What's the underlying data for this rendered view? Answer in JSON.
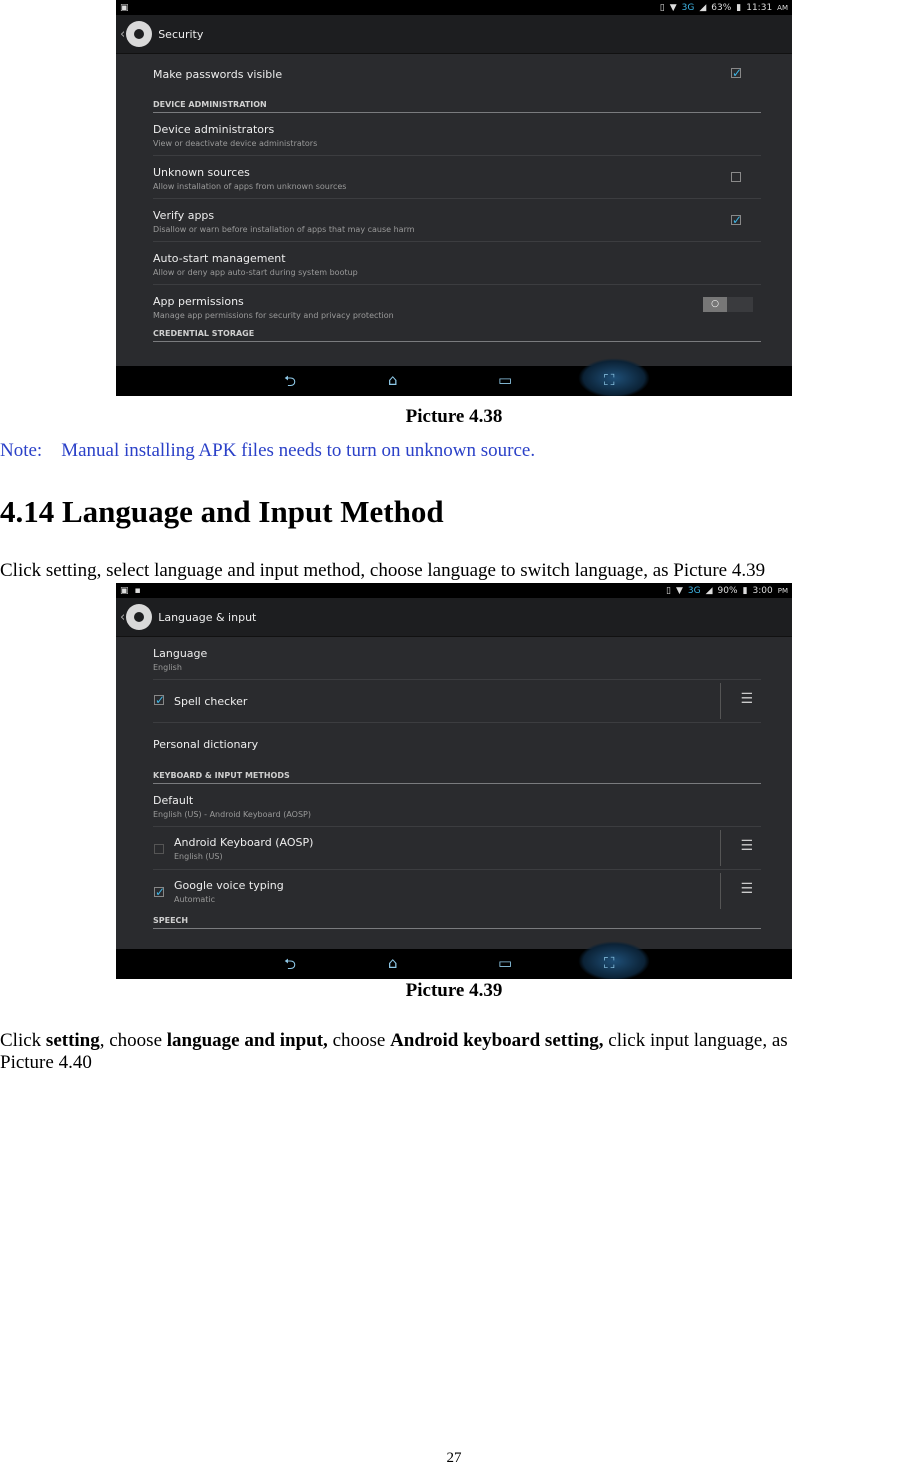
{
  "picture_38": {
    "statusbar": {
      "battery": "63%",
      "time": "11:31",
      "ampm": "AM",
      "network": "3G"
    },
    "title": "Security",
    "rows": [
      {
        "title": "Make passwords visible"
      },
      {
        "section": "DEVICE ADMINISTRATION"
      },
      {
        "title": "Device administrators",
        "subtitle": "View or deactivate device administrators"
      },
      {
        "title": "Unknown sources",
        "subtitle": "Allow installation of apps from unknown sources"
      },
      {
        "title": "Verify apps",
        "subtitle": "Disallow or warn before installation of apps that may cause harm"
      },
      {
        "title": "Auto-start management",
        "subtitle": "Allow or deny app auto-start during system bootup"
      },
      {
        "title": "App permissions",
        "subtitle": "Manage app permissions for security and privacy protection"
      },
      {
        "section": "CREDENTIAL STORAGE"
      }
    ],
    "checkbox_states": {
      "make_passwords_visible": true,
      "unknown_sources": false,
      "verify_apps": true
    },
    "app_permissions_toggle": false
  },
  "caption_38": "Picture 4.38",
  "note": "Note:    Manual installing APK files needs to turn on unknown source.",
  "heading": "4.14 Language and Input Method",
  "paragraph_1": "Click setting, select language and input method, choose language to switch language, as Picture 4.39",
  "picture_39": {
    "statusbar": {
      "battery": "90%",
      "time": "3:00",
      "ampm": "PM",
      "network": "3G"
    },
    "title": "Language & input",
    "language_title": "Language",
    "language_value": "English",
    "spell_checker": "Spell checker",
    "personal_dictionary": "Personal dictionary",
    "section_keyboard": "KEYBOARD & INPUT METHODS",
    "default_title": "Default",
    "default_value": "English (US) - Android Keyboard (AOSP)",
    "android_keyboard": "Android Keyboard (AOSP)",
    "android_keyboard_sub": "English (US)",
    "google_voice": "Google voice typing",
    "google_voice_sub": "Automatic",
    "section_speech": "SPEECH",
    "checkbox_states": {
      "spell_checker": true,
      "android_keyboard": false,
      "google_voice": true
    }
  },
  "caption_39": "Picture 4.39",
  "paragraph_2": {
    "p1": "Click ",
    "b1": "setting",
    "p2": ", choose ",
    "b2": "language and input,",
    "p3": " choose ",
    "b3": "Android keyboard setting,",
    "p4": " click input language, as",
    "line2": "Picture 4.40"
  },
  "page_number": "27",
  "colors": {
    "accent": "#3fb5e5",
    "note_text": "#2b41c8",
    "screen_bg": "#2a2b2e"
  }
}
